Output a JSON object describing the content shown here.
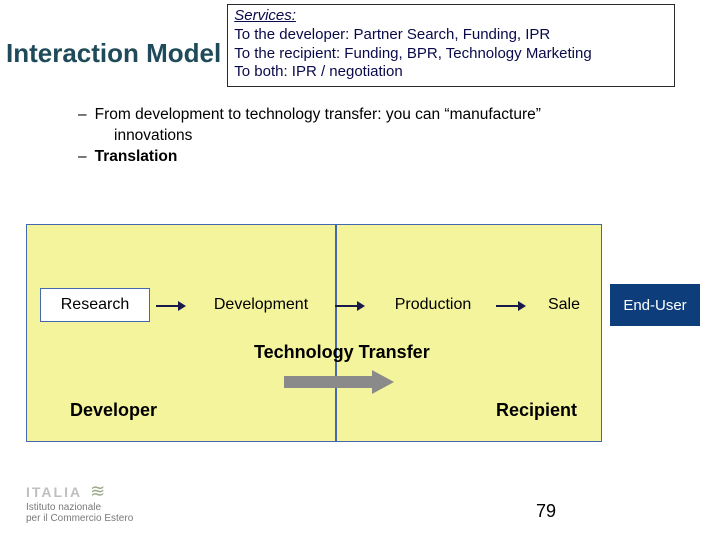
{
  "title": "Interaction Model",
  "services": {
    "heading": "Services:",
    "lines": [
      "To the developer: Partner Search, Funding, IPR",
      "To the recipient: Funding, BPR, Technology Marketing",
      "To both: IPR / negotiation"
    ]
  },
  "bullets": {
    "line1a": "From development to technology transfer: you can “manufacture”",
    "line1b": "innovations",
    "line2": "Translation"
  },
  "diagram": {
    "research": "Research",
    "development": "Development",
    "production": "Production",
    "sale": "Sale",
    "end_user": "End-User",
    "tech_transfer": "Technology Transfer",
    "developer": "Developer",
    "recipient": "Recipient"
  },
  "logo": {
    "brand": "ITALIA",
    "sub1": "Istituto nazionale",
    "sub2": "per il Commercio Estero"
  },
  "page_number": "79"
}
